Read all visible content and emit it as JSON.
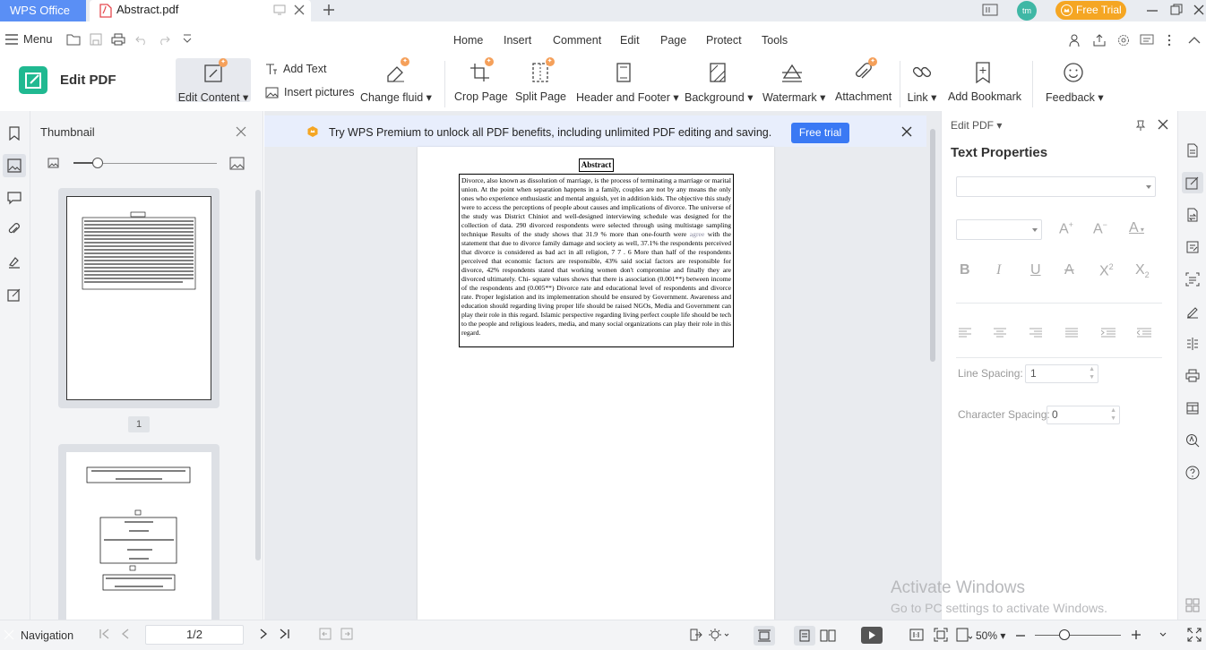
{
  "titlebar": {
    "app_tab": "WPS Office",
    "doc_tab": "Abstract.pdf",
    "free_trial": "Free Trial",
    "avatar_initials": "tm"
  },
  "menu": {
    "menu_label": "Menu",
    "tabs": [
      "Home",
      "Insert",
      "Comment",
      "Edit",
      "Page",
      "Protect",
      "Tools"
    ]
  },
  "ribbon": {
    "title": "Edit PDF",
    "edit_content": "Edit Content",
    "add_text": "Add Text",
    "insert_pictures": "Insert pictures",
    "change_fluid": "Change fluid",
    "crop_page": "Crop Page",
    "split_page": "Split Page",
    "header_footer": "Header and Footer",
    "background": "Background",
    "watermark": "Watermark",
    "attachment": "Attachment",
    "link": "Link",
    "add_bookmark": "Add Bookmark",
    "feedback": "Feedback"
  },
  "thumbnail_panel": {
    "title": "Thumbnail",
    "page_number": "1"
  },
  "premium_banner": {
    "text": "Try WPS Premium to unlock all PDF benefits, including unlimited PDF editing and saving.",
    "button": "Free trial"
  },
  "document": {
    "heading": "Abstract",
    "body_before_agree": "Divorce, also known as dissolution of marriage, is the process of terminating a marriage or marital union. At the point when separation happens in a family, couples are not by any means the only ones who experience enthusiastic and mental anguish, yet in addition kids. The objective this study were to access the perceptions of people about causes and implications of divorce. The universe of the study was District Chiniot and well-designed interviewing schedule was designed for the collection of data.  290 divorced respondents were selected through using multistage sampling technique Results of the study shows that 31.9 % more than one-fourth were ",
    "agree_word": "agree",
    "body_after_agree": " with the statement that due to divorce family damage and society as well, 37.1% the respondents perceived that divorce is considered as bad act in all religion, 7 7 . 6  More than half of the respondents perceived that economic factors are responsible, 43% said social factors are responsible for divorce, 42% respondents stated that working women don't compromise and finally they are divorced ultimately. Chi- square values shows that there is association (0.001**) between income of the respondents and (0.005**) Divorce rate and educational level of respondents and divorce rate. Proper legislation and its implementation should be ensured by Government. Awareness and education should regarding living proper life should be raised NGOs, Media and Government can play their role in this regard. Islamic perspective regarding living perfect couple life should be tech to the people and religious leaders, media, and many social organizations can play their role in this regard."
  },
  "right_panel": {
    "header": "Edit PDF",
    "title": "Text Properties",
    "line_spacing_label": "Line Spacing:",
    "line_spacing_value": "1",
    "char_spacing_label": "Character Spacing:",
    "char_spacing_value": "0"
  },
  "watermark_os": {
    "line1": "Activate Windows",
    "line2": "Go to PC settings to activate Windows."
  },
  "statusbar": {
    "navigation": "Navigation",
    "page_indicator": "1/2",
    "zoom": "50%"
  },
  "colors": {
    "accent": "#3a79f4",
    "wps_tab": "#5a8ff5",
    "edit_pdf_logo": "#20b991",
    "free_trial": "#f5a623"
  }
}
